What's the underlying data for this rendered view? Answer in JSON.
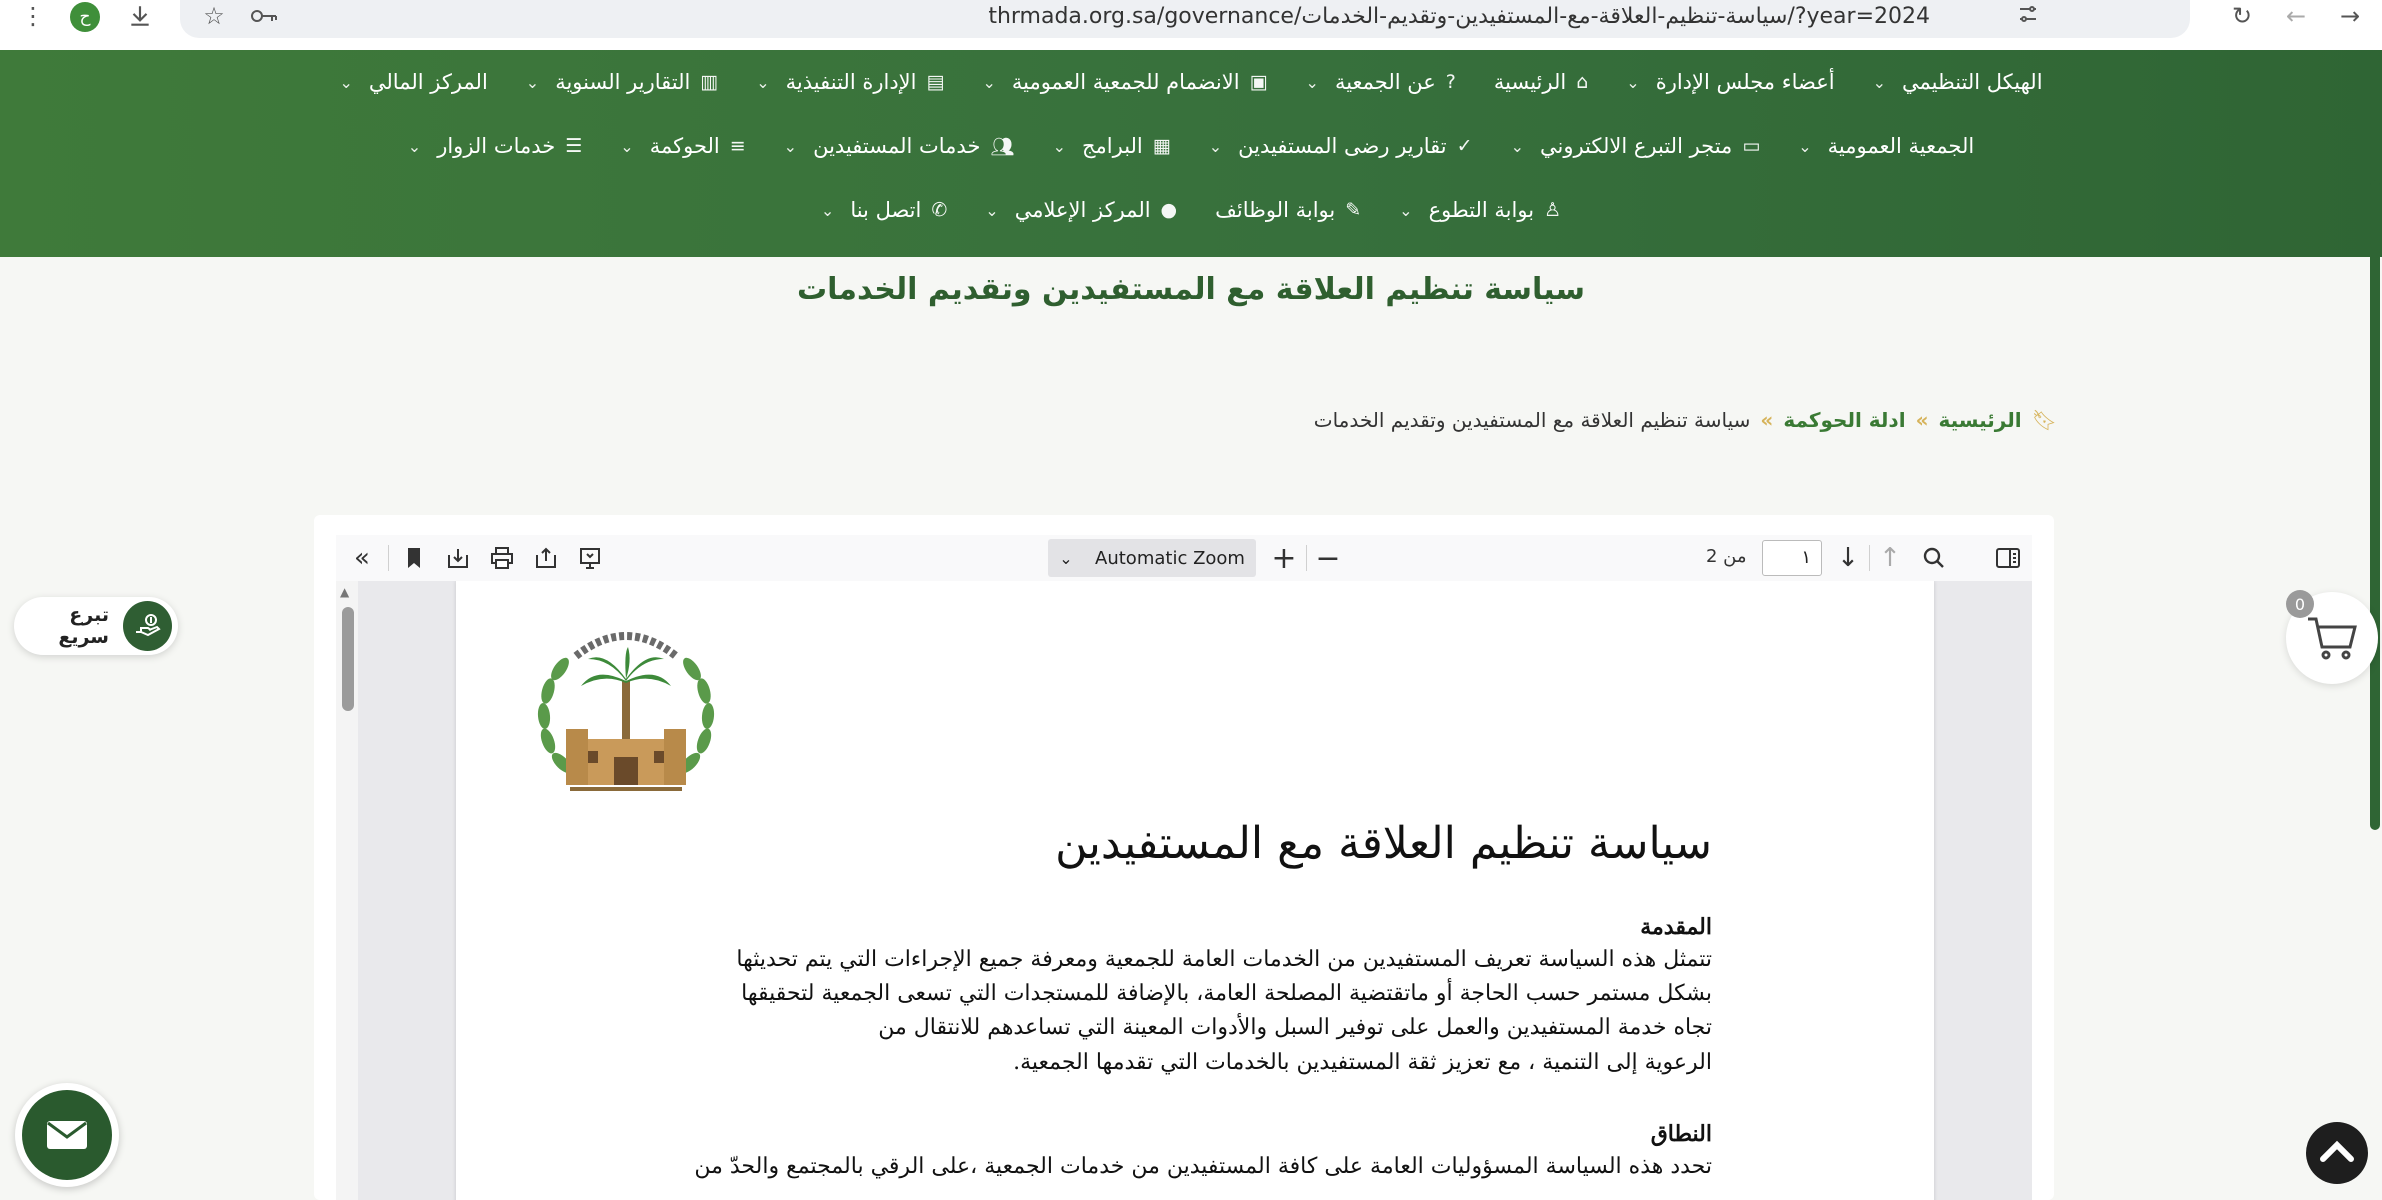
{
  "browser": {
    "url": "thrmada.org.sa/governance/سياسة-تنظيم-العلاقة-مع-المستفيدين-وتقديم-الخدمات/?year=2024",
    "profile_initial": "ح"
  },
  "nav": {
    "row1": [
      {
        "label": "الهيكل التنظيمي",
        "icon": "",
        "dropdown": true
      },
      {
        "label": "أعضاء مجلس الإدارة",
        "icon": "",
        "dropdown": true
      },
      {
        "label": "الرئيسية",
        "icon": "home-icon",
        "dropdown": false
      },
      {
        "label": "عن الجمعية",
        "icon": "question-icon",
        "dropdown": true
      },
      {
        "label": "الانضمام للجمعية العمومية",
        "icon": "id-card-icon",
        "dropdown": true
      },
      {
        "label": "الإدارة التنفيذية",
        "icon": "book-icon",
        "dropdown": true
      },
      {
        "label": "التقارير السنوية",
        "icon": "file-chart-icon",
        "dropdown": true
      },
      {
        "label": "المركز المالي",
        "icon": "",
        "dropdown": true
      }
    ],
    "row2": [
      {
        "label": "الجمعية العمومية",
        "icon": "",
        "dropdown": true
      },
      {
        "label": "متجر التبرع الالكتروني",
        "icon": "credit-card-icon",
        "dropdown": true
      },
      {
        "label": "تقارير رضى المستفيدين",
        "icon": "check-icon",
        "dropdown": true
      },
      {
        "label": "البرامج",
        "icon": "calendar-icon",
        "dropdown": true
      },
      {
        "label": "خدمات المستفيدين",
        "icon": "users-icon",
        "dropdown": true
      },
      {
        "label": "الحوكمة",
        "icon": "list-icon",
        "dropdown": true
      },
      {
        "label": "خدمات الزوار",
        "icon": "server-icon",
        "dropdown": true
      }
    ],
    "row3": [
      {
        "label": "بوابة التطوع",
        "icon": "person-icon",
        "dropdown": true
      },
      {
        "label": "بوابة الوظائف",
        "icon": "edit-square-icon",
        "dropdown": false
      },
      {
        "label": "المركز الإعلامي",
        "icon": "microphone-icon",
        "dropdown": true
      },
      {
        "label": "اتصل بنا",
        "icon": "phone-icon",
        "dropdown": true
      }
    ]
  },
  "page": {
    "title": "سياسة تنظيم العلاقة مع المستفيدين وتقديم الخدمات",
    "breadcrumb": {
      "home": "الرئيسية",
      "parent": "ادلة الحوكمة",
      "separator": "»",
      "current": "سياسة تنظيم العلاقة مع المستفيدين وتقديم الخدمات"
    }
  },
  "pdf_viewer": {
    "zoom_label": "Automatic Zoom",
    "page_current": "١",
    "page_of": "من 2"
  },
  "document": {
    "heading": "سياسة تنظيم العلاقة مع المستفيدين",
    "sections": [
      {
        "title": "المقدمة",
        "lines": [
          "تتمثل هذه السياسة تعريف المستفيدين من الخدمات العامة للجمعية ومعرفة جميع الإجراءات التي يتم تحديثها",
          "بشكل مستمر حسب الحاجة أو ماتقتضية المصلحة العامة، بالإضافة للمستجدات التي تسعى الجمعية لتحقيقها",
          "تجاه خدمة المستفيدين والعمل على توفير السبل والأدوات المعينة التي تساعدهم للانتقال من",
          "الرعوية إلى التنمية ، مع تعزيز ثقة المستفيدين بالخدمات التي تقدمها الجمعية."
        ]
      },
      {
        "title": "النطاق",
        "lines": [
          "تحدد هذه السياسة المسؤوليات العامة على كافة المستفيدين من خدمات الجمعية ،على الرقي بالمجتمع والحدّ من"
        ]
      }
    ]
  },
  "widgets": {
    "quick_donate_label": "تبرع سريع",
    "cart_count": "0"
  },
  "colors": {
    "nav_green": "#37703c",
    "title_green": "#2f5f2f",
    "accent_gold": "#d6b35a"
  }
}
